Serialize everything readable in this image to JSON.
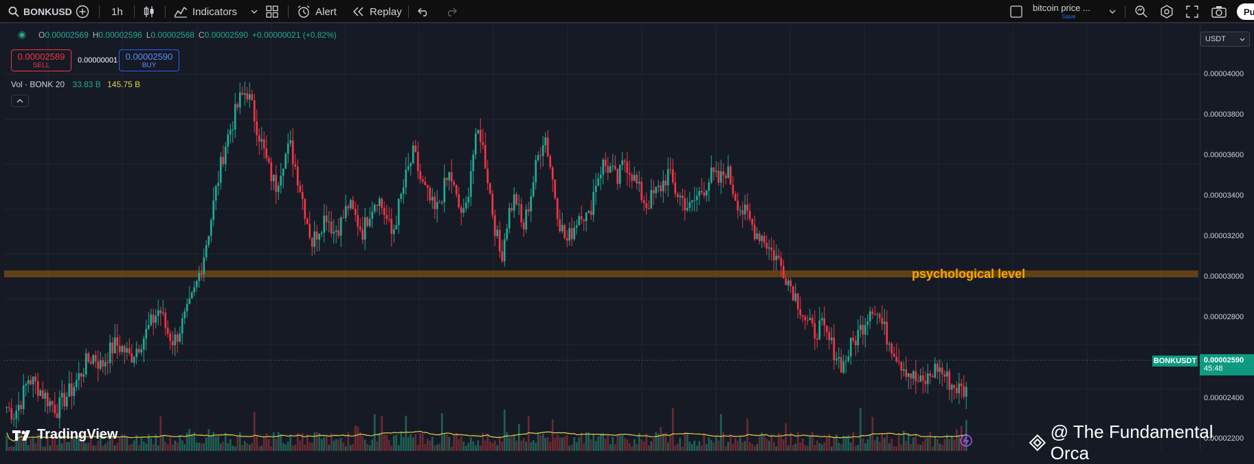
{
  "toolbar": {
    "symbol": "BONKUSD",
    "interval": "1h",
    "indicators_label": "Indicators",
    "alert_label": "Alert",
    "replay_label": "Replay",
    "layout_name": "bitcoin price ...",
    "save_label": "Save",
    "publish_label": "Pu"
  },
  "legend": {
    "ohlc": {
      "o_label": "O",
      "o": "0.00002569",
      "h_label": "H",
      "h": "0.00002596",
      "l_label": "L",
      "l": "0.00002568",
      "c_label": "C",
      "c": "0.00002590",
      "change": "+0.00000021 (+0.82%)"
    },
    "sell_price": "0.00002589",
    "sell_label": "SELL",
    "spread": "0.00000001",
    "buy_price": "0.00002590",
    "buy_label": "BUY",
    "volume": {
      "label": "Vol · BONK 20",
      "value1": "33.83 B",
      "value2": "145.75 B"
    }
  },
  "currency": "USDT",
  "price_scale": {
    "ticks": [
      "0.00004000",
      "0.00003800",
      "0.00003600",
      "0.00003400",
      "0.00003200",
      "0.00003000",
      "0.00002800",
      "0.00002600",
      "0.00002400",
      "0.00002200"
    ]
  },
  "current_price": {
    "symbol": "BONKUSDT",
    "price": "0.00002590",
    "countdown": "45:48"
  },
  "annotation": {
    "text": "psychological level",
    "level": 3e-05
  },
  "branding": {
    "logo_text": "TradingView",
    "watermark": "@ The Fundamental Orca"
  },
  "colors": {
    "up": "#22ab94",
    "down": "#f23645",
    "annotation": "#f7a600",
    "volume_ma": "#e6d345"
  },
  "chart_data": {
    "type": "candlestick",
    "ylim": [
      2.2e-05,
      4.1e-05
    ],
    "close": [
      2.52e-05,
      2.49e-05,
      2.55e-05,
      2.65e-05,
      2.62e-05,
      2.58e-05,
      2.54e-05,
      2.51e-05,
      2.56e-05,
      2.6e-05,
      2.66e-05,
      2.72e-05,
      2.75e-05,
      2.7e-05,
      2.76e-05,
      2.8e-05,
      2.78e-05,
      2.74e-05,
      2.79e-05,
      2.84e-05,
      2.9e-05,
      2.96e-05,
      2.86e-05,
      2.81e-05,
      2.88e-05,
      2.95e-05,
      3.05e-05,
      3.18e-05,
      3.34e-05,
      3.52e-05,
      3.68e-05,
      3.78e-05,
      3.88e-05,
      3.93e-05,
      3.82e-05,
      3.7e-05,
      3.58e-05,
      3.5e-05,
      3.62e-05,
      3.68e-05,
      3.55e-05,
      3.4e-05,
      3.25e-05,
      3.32e-05,
      3.38e-05,
      3.3e-05,
      3.34e-05,
      3.42e-05,
      3.36e-05,
      3.3e-05,
      3.4e-05,
      3.46e-05,
      3.38e-05,
      3.28e-05,
      3.42e-05,
      3.55e-05,
      3.65e-05,
      3.52e-05,
      3.45e-05,
      3.38e-05,
      3.48e-05,
      3.56e-05,
      3.42e-05,
      3.36e-05,
      3.62e-05,
      3.76e-05,
      3.58e-05,
      3.35e-05,
      3.18e-05,
      3.38e-05,
      3.46e-05,
      3.3e-05,
      3.45e-05,
      3.62e-05,
      3.74e-05,
      3.55e-05,
      3.35e-05,
      3.25e-05,
      3.32e-05,
      3.4e-05,
      3.35e-05,
      3.52e-05,
      3.6e-05,
      3.58e-05,
      3.52e-05,
      3.62e-05,
      3.56e-05,
      3.48e-05,
      3.42e-05,
      3.46e-05,
      3.5e-05,
      3.56e-05,
      3.48e-05,
      3.44e-05,
      3.4e-05,
      3.46e-05,
      3.5e-05,
      3.55e-05,
      3.52e-05,
      3.58e-05,
      3.48e-05,
      3.4e-05,
      3.36e-05,
      3.3e-05,
      3.28e-05,
      3.22e-05,
      3.18e-05,
      3.12e-05,
      3.05e-05,
      2.98e-05,
      2.9e-05,
      2.85e-05,
      2.88e-05,
      2.82e-05,
      2.76e-05,
      2.7e-05,
      2.78e-05,
      2.84e-05,
      2.9e-05,
      2.98e-05,
      2.92e-05,
      2.84e-05,
      2.78e-05,
      2.72e-05,
      2.68e-05,
      2.64e-05,
      2.62e-05,
      2.66e-05,
      2.7e-05,
      2.66e-05,
      2.62e-05,
      2.6e-05,
      2.59e-05
    ]
  }
}
